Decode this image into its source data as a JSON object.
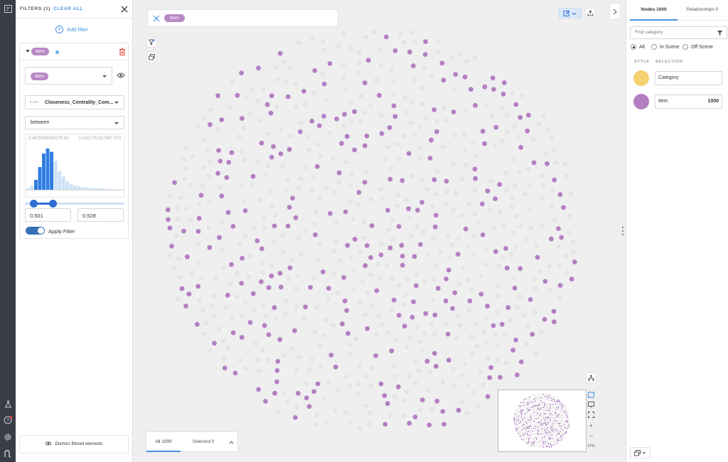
{
  "filters": {
    "title": "FILTERS (1)",
    "clear_all": "CLEAR ALL",
    "add_filter": "Add filter",
    "card": {
      "category": "Item",
      "category_select": "Item",
      "property_type": "0.123",
      "property": "Closeness_Centrality_Com...",
      "operator": "between",
      "range_min": "0.4870456303170 82",
      "range_max": "0.6311701327987 973",
      "histogram": [
        0.04,
        0.1,
        0.24,
        0.55,
        0.88,
        1.0,
        0.92,
        0.7,
        0.45,
        0.32,
        0.2,
        0.14,
        0.1,
        0.08,
        0.06,
        0.05,
        0.04,
        0.04,
        0.03,
        0.03,
        0.02,
        0.02,
        0.02,
        0.01,
        0.01
      ],
      "selected_fraction": [
        0.1,
        0.29
      ],
      "min_value": "0.501",
      "max_value": "0.528",
      "apply_label": "Apply Filter",
      "apply_on": true
    },
    "dismiss": "Dismiss filtered elements"
  },
  "canvas": {
    "search_pill": "Item",
    "tabs": {
      "all": "All 1000",
      "selected": "Selected 0"
    },
    "zoom_level": "37%",
    "node_color": "#b47fc2",
    "filtered_node_color": "#e4e4e4"
  },
  "right_panel": {
    "tabs": {
      "nodes": "Nodes 1000",
      "relationships": "Relationships 0"
    },
    "find_placeholder": "Find category",
    "radios": [
      "All",
      "In Scene",
      "Off Scene"
    ],
    "selected_radio": "All",
    "headers": {
      "style": "STYLE",
      "selection": "SELECTION"
    },
    "categories": [
      {
        "name": "Category",
        "count": "",
        "color": "#f4d06f"
      },
      {
        "name": "Item",
        "count": "1000",
        "color": "#b47fc2"
      }
    ]
  },
  "colors": {
    "accent": "#4a90e2",
    "rail": "#3a3d45",
    "toggle": "#3670b8",
    "histogram_selected": "#2f7de1",
    "histogram_other": "#cfe1f7"
  }
}
